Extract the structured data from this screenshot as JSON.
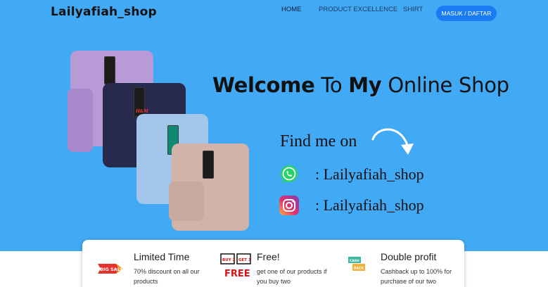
{
  "brand": "Lailyafiah_shop",
  "nav": {
    "home": "HOME",
    "product_excellence": "PRODUCT EXCELLENCE",
    "shirt": "SHIRT",
    "login": "MASUK / DAFTAR"
  },
  "hero": {
    "headline_w1": "Welcome",
    "headline_w2": "To",
    "headline_w3": "My",
    "headline_w4": "Online Shop",
    "find_me": "Find me on",
    "whatsapp_handle": ": Lailyafiah_shop",
    "instagram_handle": ": Lailyafiah_shop",
    "tag_logo": "H&M"
  },
  "features": [
    {
      "title": "Limited Time",
      "desc": "70% discount on all our products",
      "icon": "big-sale-icon",
      "icon_text": "BIG SALE"
    },
    {
      "title": "Free!",
      "desc": "get one of our products if you buy two",
      "icon": "buy2-get1-free-icon",
      "icon_text_1": "BUY 2",
      "icon_text_2": "GET 1",
      "icon_text_3": "FREE!"
    },
    {
      "title": "Double profit",
      "desc": "Cashback up to 100% for purchase of our two",
      "icon": "cashback-icon",
      "icon_text_1": "CASH",
      "icon_text_2": "BACK"
    }
  ],
  "colors": {
    "hero_bg": "#42aaf5",
    "button": "#1a7cf2",
    "whatsapp": "#25d366"
  }
}
